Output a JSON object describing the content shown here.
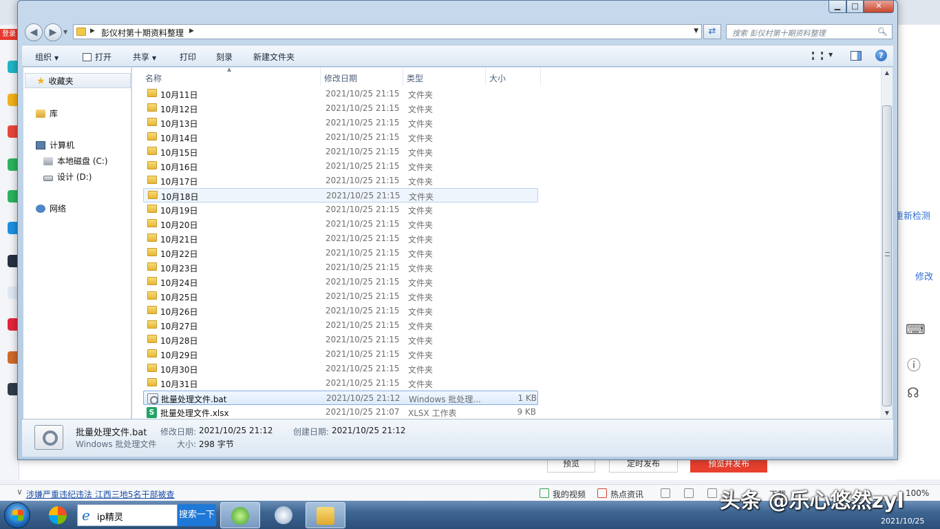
{
  "window": {
    "minimize": "▁",
    "maximize": "□",
    "close": "✕"
  },
  "address": {
    "path": "彭仪村第十期资料整理",
    "search_placeholder": "搜索 彭仪村第十期资料整理"
  },
  "toolbar": {
    "organize": "组织",
    "open": "打开",
    "share": "共享",
    "print": "打印",
    "burn": "刻录",
    "new_folder": "新建文件夹",
    "help": "?"
  },
  "nav": {
    "favorites": "收藏夹",
    "libraries": "库",
    "computer": "计算机",
    "drive_c": "本地磁盘 (C:)",
    "drive_d": "设计 (D:)",
    "network": "网络"
  },
  "columns": {
    "name": "名称",
    "date": "修改日期",
    "type": "类型",
    "size": "大小"
  },
  "files": [
    {
      "name": "10月11日",
      "date": "2021/10/25 21:15",
      "type": "文件夹",
      "size": ""
    },
    {
      "name": "10月12日",
      "date": "2021/10/25 21:15",
      "type": "文件夹",
      "size": ""
    },
    {
      "name": "10月13日",
      "date": "2021/10/25 21:15",
      "type": "文件夹",
      "size": ""
    },
    {
      "name": "10月14日",
      "date": "2021/10/25 21:15",
      "type": "文件夹",
      "size": ""
    },
    {
      "name": "10月15日",
      "date": "2021/10/25 21:15",
      "type": "文件夹",
      "size": ""
    },
    {
      "name": "10月16日",
      "date": "2021/10/25 21:15",
      "type": "文件夹",
      "size": ""
    },
    {
      "name": "10月17日",
      "date": "2021/10/25 21:15",
      "type": "文件夹",
      "size": ""
    },
    {
      "name": "10月18日",
      "date": "2021/10/25 21:15",
      "type": "文件夹",
      "size": ""
    },
    {
      "name": "10月19日",
      "date": "2021/10/25 21:15",
      "type": "文件夹",
      "size": ""
    },
    {
      "name": "10月20日",
      "date": "2021/10/25 21:15",
      "type": "文件夹",
      "size": ""
    },
    {
      "name": "10月21日",
      "date": "2021/10/25 21:15",
      "type": "文件夹",
      "size": ""
    },
    {
      "name": "10月22日",
      "date": "2021/10/25 21:15",
      "type": "文件夹",
      "size": ""
    },
    {
      "name": "10月23日",
      "date": "2021/10/25 21:15",
      "type": "文件夹",
      "size": ""
    },
    {
      "name": "10月24日",
      "date": "2021/10/25 21:15",
      "type": "文件夹",
      "size": ""
    },
    {
      "name": "10月25日",
      "date": "2021/10/25 21:15",
      "type": "文件夹",
      "size": ""
    },
    {
      "name": "10月26日",
      "date": "2021/10/25 21:15",
      "type": "文件夹",
      "size": ""
    },
    {
      "name": "10月27日",
      "date": "2021/10/25 21:15",
      "type": "文件夹",
      "size": ""
    },
    {
      "name": "10月28日",
      "date": "2021/10/25 21:15",
      "type": "文件夹",
      "size": ""
    },
    {
      "name": "10月29日",
      "date": "2021/10/25 21:15",
      "type": "文件夹",
      "size": ""
    },
    {
      "name": "10月30日",
      "date": "2021/10/25 21:15",
      "type": "文件夹",
      "size": ""
    },
    {
      "name": "10月31日",
      "date": "2021/10/25 21:15",
      "type": "文件夹",
      "size": ""
    },
    {
      "name": "批量处理文件.bat",
      "date": "2021/10/25 21:12",
      "type": "Windows 批处理...",
      "size": "1 KB"
    },
    {
      "name": "批量处理文件.xlsx",
      "date": "2021/10/25 21:07",
      "type": "XLSX 工作表",
      "size": "9 KB"
    }
  ],
  "details": {
    "filename": "批量处理文件.bat",
    "filetype": "Windows 批处理文件",
    "modified_label": "修改日期:",
    "modified_value": "2021/10/25 21:12",
    "created_label": "创建日期:",
    "created_value": "2021/10/25 21:12",
    "size_label": "大小:",
    "size_value": "298 字节"
  },
  "background": {
    "login": "登录",
    "right_link1": "重新检测",
    "right_link2": "修改",
    "btn_preview": "预览",
    "btn_schedule": "定时发布",
    "btn_publish": "预览并发布"
  },
  "statusbar": {
    "news": "涉嫌严重违纪违法 江西三地5名干部被查",
    "my_video": "我的视频",
    "hot_news": "热点资讯",
    "download": "下载",
    "zoom": "100%"
  },
  "taskbar": {
    "ie_text": "ip精灵",
    "search_btn": "搜索一下",
    "watermark": "头条 @乐心悠然zyl",
    "date": "2021/10/25"
  }
}
